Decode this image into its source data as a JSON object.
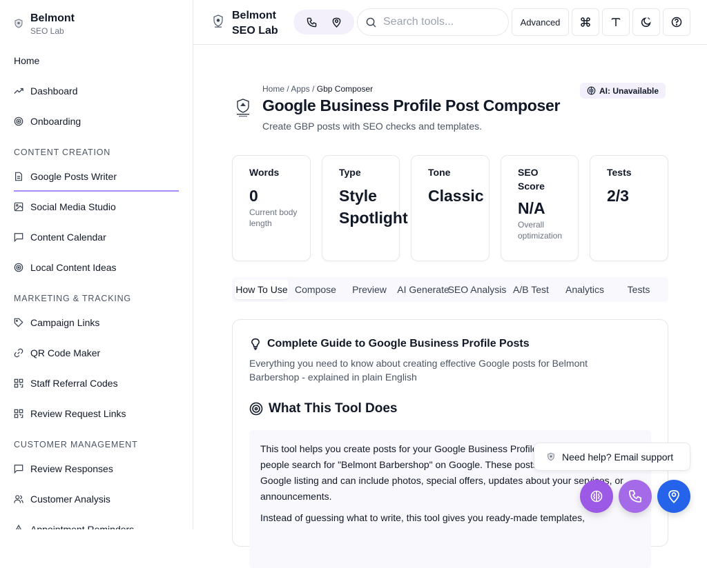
{
  "sidebar": {
    "brand_name": "Belmont",
    "brand_sub": "SEO Lab",
    "items": [
      {
        "label": "Home"
      },
      {
        "label": "Dashboard"
      },
      {
        "label": "Onboarding"
      },
      {
        "label": "Google Posts Writer"
      },
      {
        "label": "Social Media Studio"
      },
      {
        "label": "Content Calendar"
      },
      {
        "label": "Local Content Ideas"
      },
      {
        "label": "Campaign Links"
      },
      {
        "label": "QR Code Maker"
      },
      {
        "label": "Staff Referral Codes"
      },
      {
        "label": "Review Request Links"
      },
      {
        "label": "Review Responses"
      },
      {
        "label": "Customer Analysis"
      },
      {
        "label": "Appointment Reminders"
      }
    ],
    "sections": {
      "content": "CONTENT CREATION",
      "marketing": "MARKETING & TRACKING",
      "customer": "CUSTOMER MANAGEMENT"
    },
    "active_item": "Google Posts Writer",
    "accent": "#a78bfa"
  },
  "topbar": {
    "brand_line1": "Belmont",
    "brand_line2": "SEO Lab",
    "search_placeholder": "Search tools...",
    "advanced_label": "Advanced",
    "icons": [
      "phone-icon",
      "map-pin-icon",
      "search-icon",
      "command-icon",
      "text-icon",
      "theme-icon",
      "help-icon"
    ]
  },
  "page": {
    "breadcrumb": {
      "home": "Home",
      "apps": "Apps",
      "current": "Gbp Composer",
      "sep": "/"
    },
    "title": "Google Business Profile Post Composer",
    "subtitle": "Create GBP posts with SEO checks and templates.",
    "ai_status": "AI: Unavailable"
  },
  "stats": [
    {
      "label": "Words",
      "value": "0",
      "note": "Current body length"
    },
    {
      "label": "Type",
      "value": "Style Spotlight",
      "note": ""
    },
    {
      "label": "Tone",
      "value": "Classic",
      "note": ""
    },
    {
      "label": "SEO Score",
      "value": "N/A",
      "note": "Overall optimization"
    },
    {
      "label": "Tests",
      "value": "2/3",
      "note": ""
    }
  ],
  "tabs": [
    {
      "label": "How To Use"
    },
    {
      "label": "Compose"
    },
    {
      "label": "Preview"
    },
    {
      "label": "AI Generate"
    },
    {
      "label": "SEO Analysis"
    },
    {
      "label": "A/B Test"
    },
    {
      "label": "Analytics"
    },
    {
      "label": "Tests"
    }
  ],
  "active_tab": "How To Use",
  "guide": {
    "title": "Complete Guide to Google Business Profile Posts",
    "subtitle": "Everything you need to know about creating effective Google posts for Belmont Barbershop - explained in plain English",
    "section_title": "What This Tool Does",
    "paragraph1": "This tool helps you create posts for your Google Business Profile - that shows up when people search for \"Belmont Barbershop\" on Google. These posts appear right on your Google listing and can include photos, special offers, updates about your services, or announcements.",
    "paragraph2": "Instead of guessing what to write, this tool gives you ready-made templates,"
  },
  "support": {
    "help_text": "Need help? Email support",
    "fab_colors": [
      "#9b59e6",
      "#a56ae8",
      "#2563eb"
    ]
  }
}
